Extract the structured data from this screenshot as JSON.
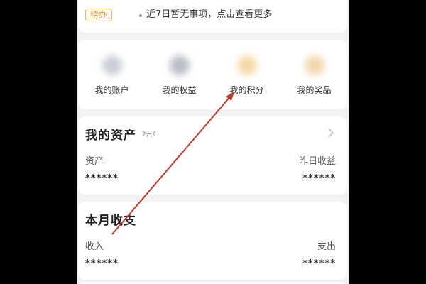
{
  "todo": {
    "tag": "待办",
    "text": "近7日暂无事项，点击查看更多"
  },
  "menu": {
    "items": [
      {
        "label": "我的账户",
        "icon": "account-icon",
        "color": "#c9ced6"
      },
      {
        "label": "我的权益",
        "icon": "benefits-icon",
        "color": "#b9bec6"
      },
      {
        "label": "我的积分",
        "icon": "points-icon",
        "color": "#f3d9a6"
      },
      {
        "label": "我的奖品",
        "icon": "prizes-icon",
        "color": "#f1d7b0"
      }
    ]
  },
  "assets": {
    "title": "我的资产",
    "left_label": "资产",
    "right_label": "昨日收益",
    "left_value": "******",
    "right_value": "******"
  },
  "month": {
    "title": "本月收支",
    "left_label": "收入",
    "right_label": "支出",
    "left_value": "******",
    "right_value": "******"
  },
  "annotation": {
    "color": "#c0392b"
  }
}
